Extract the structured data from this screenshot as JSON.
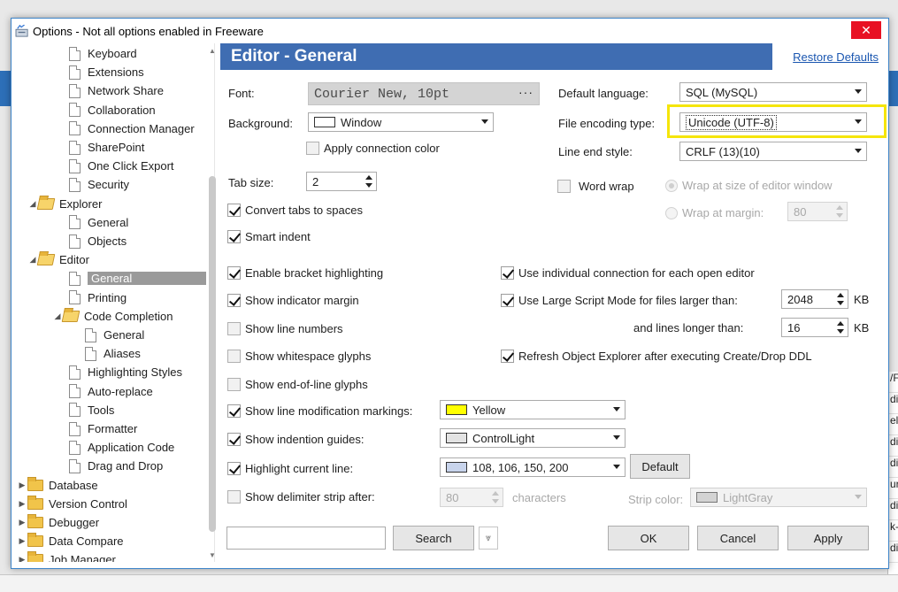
{
  "window": {
    "title": "Options - Not all options enabled in Freeware",
    "close": "✕"
  },
  "tree": {
    "items": [
      {
        "label": "Keyboard",
        "type": "page"
      },
      {
        "label": "Extensions",
        "type": "page"
      },
      {
        "label": "Network Share",
        "type": "page"
      },
      {
        "label": "Collaboration",
        "type": "page"
      },
      {
        "label": "Connection Manager",
        "type": "page"
      },
      {
        "label": "SharePoint",
        "type": "page"
      },
      {
        "label": "One Click Export",
        "type": "page"
      },
      {
        "label": "Security",
        "type": "page"
      },
      {
        "label": "Explorer",
        "type": "folder-open"
      },
      {
        "label": "General",
        "type": "page"
      },
      {
        "label": "Objects",
        "type": "page"
      },
      {
        "label": "Editor",
        "type": "folder-open"
      },
      {
        "label": "General",
        "type": "page",
        "selected": true
      },
      {
        "label": "Printing",
        "type": "page"
      },
      {
        "label": "Code Completion",
        "type": "folder-open"
      },
      {
        "label": "General",
        "type": "page"
      },
      {
        "label": "Aliases",
        "type": "page"
      },
      {
        "label": "Highlighting Styles",
        "type": "page"
      },
      {
        "label": "Auto-replace",
        "type": "page"
      },
      {
        "label": "Tools",
        "type": "page"
      },
      {
        "label": "Formatter",
        "type": "page"
      },
      {
        "label": "Application Code",
        "type": "page"
      },
      {
        "label": "Drag and Drop",
        "type": "page"
      },
      {
        "label": "Database",
        "type": "folder"
      },
      {
        "label": "Version Control",
        "type": "folder"
      },
      {
        "label": "Debugger",
        "type": "folder"
      },
      {
        "label": "Data Compare",
        "type": "folder"
      },
      {
        "label": "Job Manager",
        "type": "folder"
      }
    ]
  },
  "header": {
    "title": "Editor - General",
    "restore_defaults": "Restore Defaults"
  },
  "form": {
    "font_label": "Font:",
    "font_value": "Courier New, 10pt",
    "font_browse": "···",
    "background_label": "Background:",
    "background_value": "Window",
    "apply_connection_color": "Apply connection color",
    "default_language_label": "Default language:",
    "default_language_value": "SQL (MySQL)",
    "file_encoding_label": "File encoding type:",
    "file_encoding_value": "Unicode (UTF-8)",
    "line_end_label": "Line end style:",
    "line_end_value": "CRLF (13)(10)",
    "tab_size_label": "Tab size:",
    "tab_size_value": "2",
    "word_wrap": "Word wrap",
    "wrap_editor_window": "Wrap at size of editor window",
    "wrap_margin": "Wrap at margin:",
    "wrap_margin_value": "80",
    "convert_tabs": "Convert tabs to spaces",
    "smart_indent": "Smart indent",
    "bracket_highlighting": "Enable bracket highlighting",
    "indicator_margin": "Show indicator margin",
    "line_numbers": "Show line numbers",
    "whitespace_glyphs": "Show whitespace glyphs",
    "eol_glyphs": "Show end-of-line glyphs",
    "line_mod_markings": "Show line modification markings:",
    "line_mod_color": "Yellow",
    "indention_guides": "Show indention guides:",
    "indention_color": "ControlLight",
    "highlight_current_line": "Highlight current line:",
    "highlight_color": "108, 106, 150, 200",
    "default_button": "Default",
    "delimiter_strip": "Show delimiter strip after:",
    "delimiter_value": "80",
    "characters": "characters",
    "strip_color_label": "Strip color:",
    "strip_color_value": "LightGray",
    "individual_connection": "Use individual connection for each open editor",
    "large_script_mode": "Use Large Script Mode for files larger than:",
    "large_script_value": "2048",
    "kb1": "KB",
    "lines_longer": "and lines longer than:",
    "lines_longer_value": "16",
    "kb2": "KB",
    "refresh_explorer": "Refresh Object Explorer after executing Create/Drop DDL"
  },
  "footer": {
    "search_placeholder": "",
    "search_button": "Search",
    "ok": "OK",
    "cancel": "Cancel",
    "apply": "Apply"
  },
  "colors": {
    "header_bg": "#3f6db2",
    "highlight_frame": "#f5e50a",
    "swatch_yellow": "#ffff00",
    "swatch_controllight": "#e3e3e3",
    "swatch_highlight": "#c8d4ec",
    "swatch_lightgray": "#d3d3d3"
  },
  "bg_right_fragments": [
    "/F",
    "di",
    "el",
    "di",
    "di",
    "ur",
    "di",
    "k-",
    "di"
  ],
  "bg_left_fragments": [
    "V",
    "E",
    "(",
    "(",
    "(",
    "(",
    "(",
    "(",
    "(",
    "("
  ]
}
